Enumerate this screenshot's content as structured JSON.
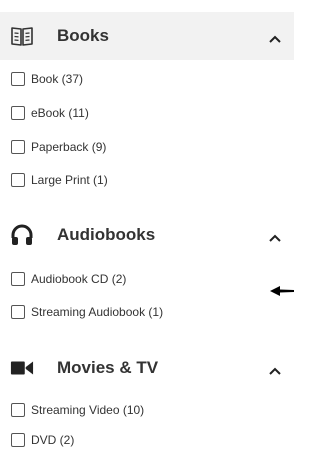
{
  "sections": [
    {
      "title": "Books",
      "icon": "open-book-icon",
      "expanded": true,
      "options": [
        {
          "label": "Book (37)",
          "checked": false
        },
        {
          "label": "eBook (11)",
          "checked": false
        },
        {
          "label": "Paperback (9)",
          "checked": false
        },
        {
          "label": "Large Print (1)",
          "checked": false
        }
      ]
    },
    {
      "title": "Audiobooks",
      "icon": "headphones-icon",
      "expanded": true,
      "options": [
        {
          "label": "Audiobook CD (2)",
          "checked": false
        },
        {
          "label": "Streaming Audiobook (1)",
          "checked": false
        }
      ]
    },
    {
      "title": "Movies & TV",
      "icon": "video-camera-icon",
      "expanded": true,
      "options": [
        {
          "label": "Streaming Video (10)",
          "checked": false
        },
        {
          "label": "DVD (2)",
          "checked": false
        }
      ]
    }
  ],
  "annotation": {
    "icon": "left-arrow-icon"
  }
}
